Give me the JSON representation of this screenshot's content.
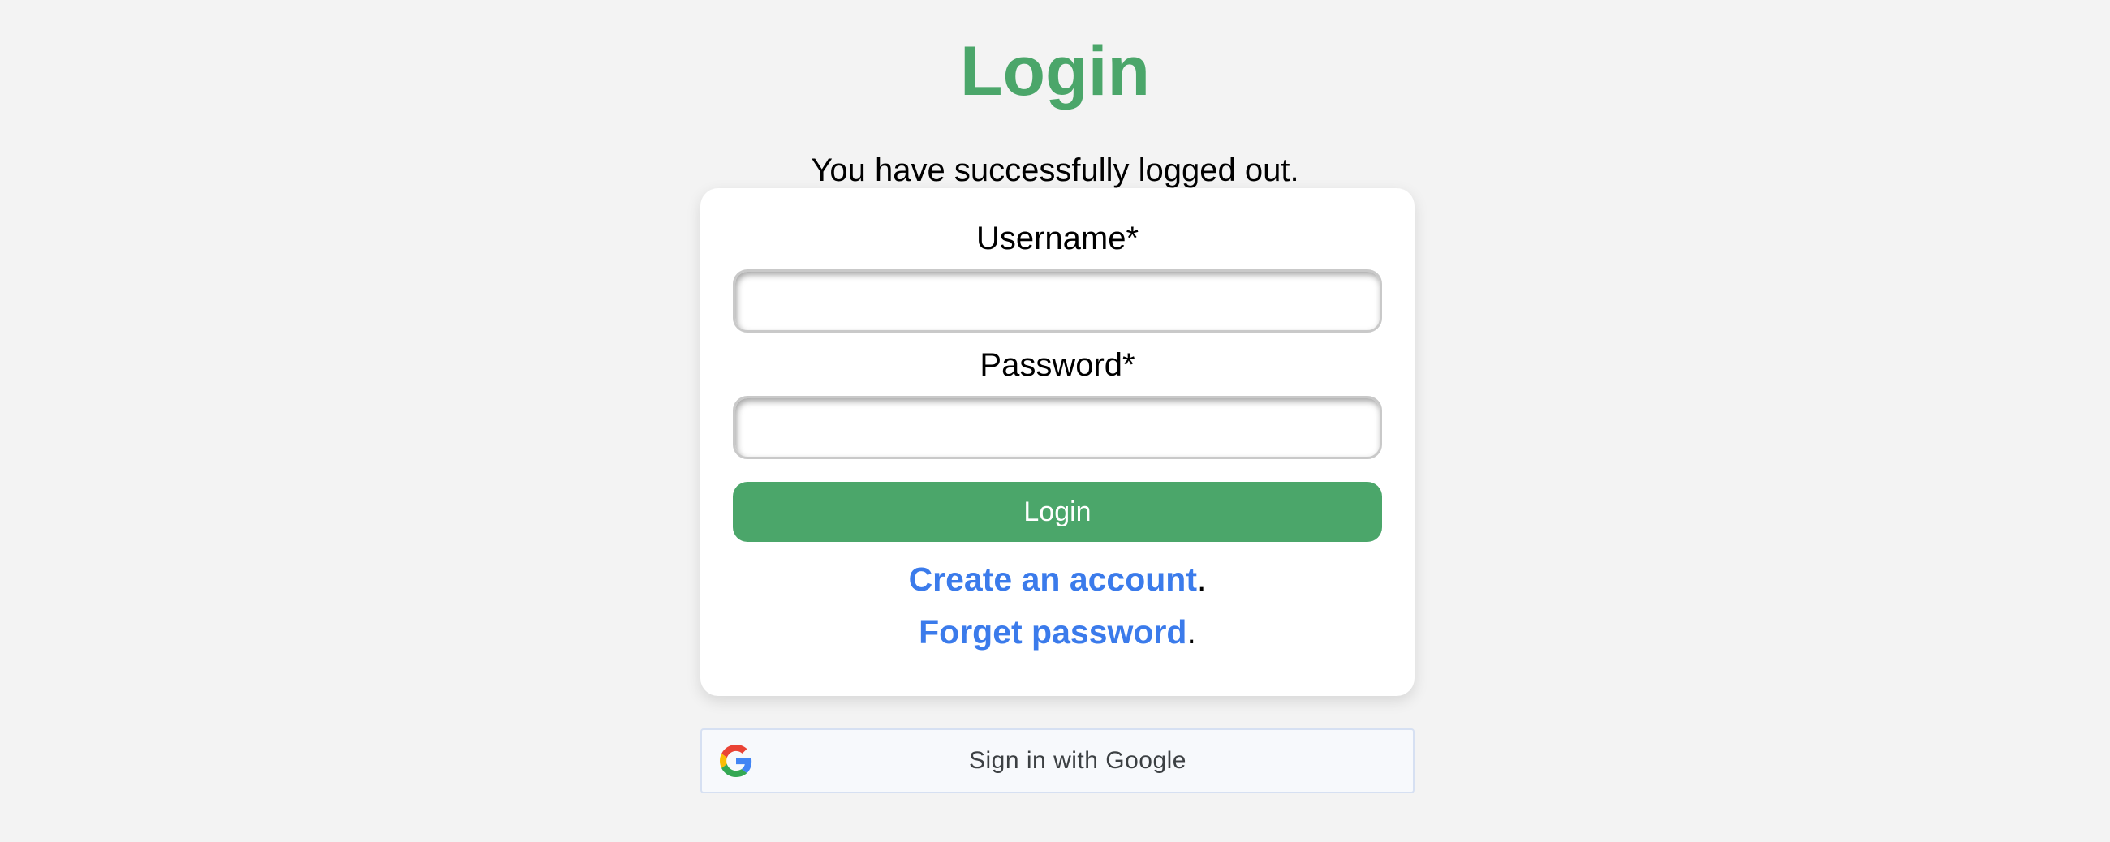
{
  "page": {
    "title": "Login",
    "message": "You have successfully logged out."
  },
  "form": {
    "username_label": "Username*",
    "username_value": "",
    "password_label": "Password*",
    "password_value": "",
    "submit_label": "Login"
  },
  "links": {
    "create_account": "Create an account",
    "create_account_suffix": ".",
    "forget_password": "Forget password",
    "forget_password_suffix": "."
  },
  "google": {
    "label": "Sign in with Google",
    "icon": "google-g-icon"
  },
  "colors": {
    "brand_green": "#4ba66a",
    "link_blue": "#3b7beb",
    "background": "#f3f3f3",
    "card": "#ffffff"
  }
}
